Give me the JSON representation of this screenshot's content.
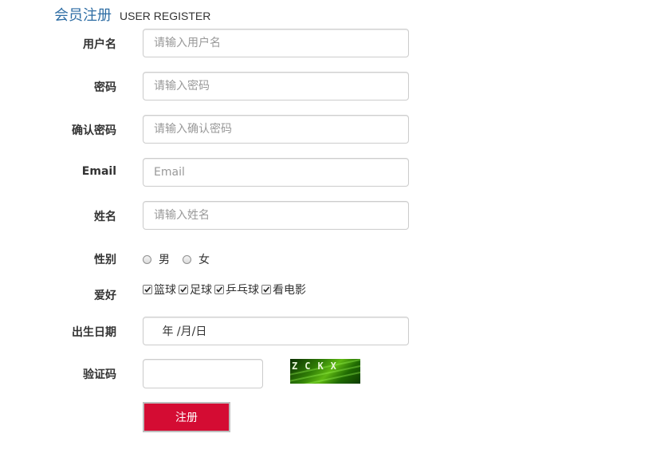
{
  "header": {
    "title_cn": "会员注册",
    "title_en": "USER REGISTER"
  },
  "form": {
    "username": {
      "label": "用户名",
      "placeholder": "请输入用户名",
      "value": ""
    },
    "password": {
      "label": "密码",
      "placeholder": "请输入密码",
      "value": ""
    },
    "confirm_password": {
      "label": "确认密码",
      "placeholder": "请输入确认密码",
      "value": ""
    },
    "email": {
      "label": "Email",
      "placeholder": "Email",
      "value": ""
    },
    "name": {
      "label": "姓名",
      "placeholder": "请输入姓名",
      "value": ""
    },
    "gender": {
      "label": "性别",
      "options": [
        {
          "label": "男",
          "checked": false
        },
        {
          "label": "女",
          "checked": false
        }
      ]
    },
    "hobbies": {
      "label": "爱好",
      "options": [
        {
          "label": "篮球",
          "checked": true
        },
        {
          "label": "足球",
          "checked": true
        },
        {
          "label": "乒乓球",
          "checked": true
        },
        {
          "label": "看电影",
          "checked": true
        }
      ]
    },
    "birthday": {
      "label": "出生日期",
      "display": " 年 /月/日"
    },
    "captcha": {
      "label": "验证码",
      "value": "",
      "image_text": "ZCKX"
    },
    "submit_label": "注册"
  },
  "colors": {
    "title_blue": "#2e6da4",
    "submit_red": "#d40c33",
    "border_gray": "#cccccc",
    "placeholder_gray": "#999999"
  }
}
